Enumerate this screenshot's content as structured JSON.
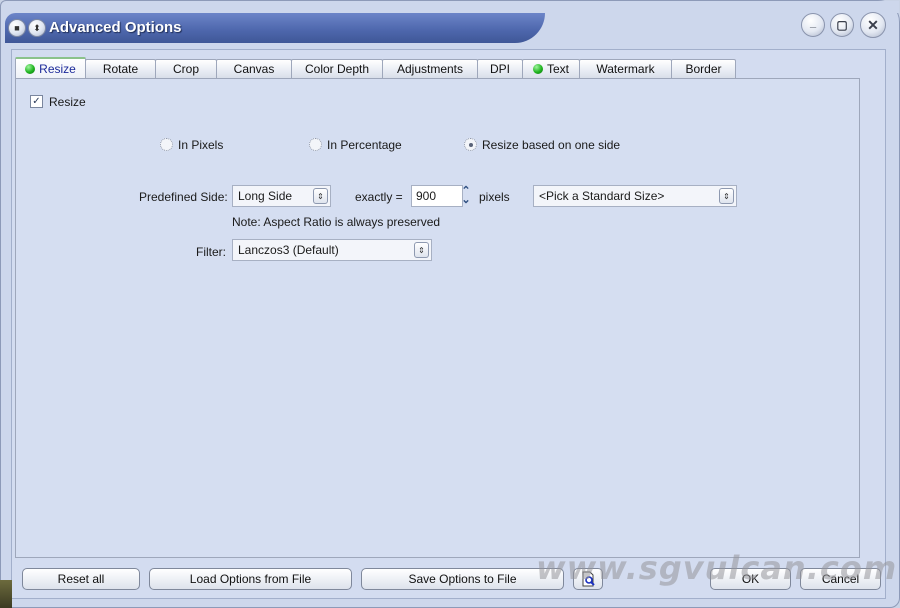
{
  "window": {
    "title": "Advanced Options",
    "controls": {
      "minimize": "_",
      "maximize": "▢",
      "close": "✕"
    },
    "system_icons": [
      "menu-icon",
      "rollup-icon"
    ]
  },
  "tabs": [
    {
      "label": "Resize",
      "active": true,
      "indicator": "green-dot"
    },
    {
      "label": "Rotate",
      "active": false
    },
    {
      "label": "Crop",
      "active": false
    },
    {
      "label": "Canvas",
      "active": false
    },
    {
      "label": "Color Depth",
      "active": false
    },
    {
      "label": "Adjustments",
      "active": false
    },
    {
      "label": "DPI",
      "active": false
    },
    {
      "label": "Text",
      "active": false,
      "indicator": "green-dot"
    },
    {
      "label": "Watermark",
      "active": false
    },
    {
      "label": "Border",
      "active": false
    }
  ],
  "resize": {
    "enable_checkbox": {
      "label": "Resize",
      "checked": true,
      "check_glyph": "✓"
    },
    "mode_options": [
      {
        "label": "In Pixels",
        "selected": false
      },
      {
        "label": "In Percentage",
        "selected": false
      },
      {
        "label": "Resize based on one side",
        "selected": true
      }
    ],
    "predefined_side_label": "Predefined Side:",
    "predefined_side_value": "Long Side",
    "exactly_label": "exactly =",
    "size_value": "900",
    "size_unit": "pixels",
    "standard_size_value": "<Pick a Standard Size>",
    "note": "Note: Aspect Ratio is always preserved",
    "filter_label": "Filter:",
    "filter_value": "Lanczos3 (Default)"
  },
  "footer": {
    "reset_label": "Reset all",
    "load_label": "Load Options from File",
    "save_label": "Save Options to File",
    "preview_icon": "preview-document-icon",
    "ok_label": "OK",
    "cancel_label": "Cancel"
  },
  "watermark_text": "www.sgvulcan.com",
  "colors": {
    "titlebar": "#4f68ae",
    "active_tab_text": "#1c2a9a",
    "indicator_green": "#1fb41f",
    "panel_bg": "#d5def1"
  }
}
